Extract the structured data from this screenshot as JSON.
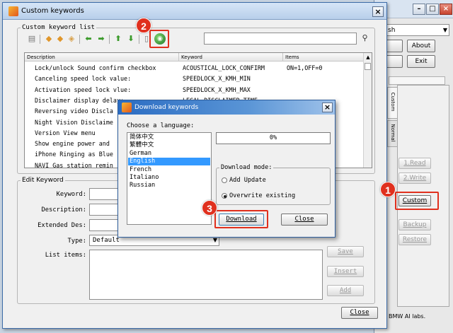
{
  "main_app": {
    "lang_select_value": "sh",
    "buttons": {
      "about": "About",
      "exit": "Exit"
    },
    "vtabs": [
      "Custom",
      "Normal"
    ],
    "side_buttons": {
      "read": "1.Read",
      "write": "2.Write",
      "custom": "Custom",
      "backup": "Backup",
      "restore": "Restore"
    },
    "status_text": "BMW AI labs."
  },
  "kw_window": {
    "title": "Custom keywords",
    "close_glyph": "×",
    "list_group_label": "Custom keyword list",
    "columns": [
      "Description",
      "Keyword",
      "Items"
    ],
    "rows": [
      {
        "description": "Lock/unlock Sound confirm checkbox",
        "keyword": "ACOUSTICAL_LOCK_CONFIRM",
        "items": "ON=1,OFF=0"
      },
      {
        "description": "Canceling speed lock value:",
        "keyword": "SPEEDLOCK_X_KMH_MIN",
        "items": ""
      },
      {
        "description": "Activation speed lock vlue:",
        "keyword": "SPEEDLOCK_X_KMH_MAX",
        "items": ""
      },
      {
        "description": "Disclaimer display delay:",
        "keyword": "LEGAL_DISCLAIMER_TIME",
        "items": ""
      },
      {
        "description": "Reversing video Discla",
        "keyword": "",
        "items": ""
      },
      {
        "description": "Night Vision Disclaime",
        "keyword": "",
        "items": ""
      },
      {
        "description": "Version View menu",
        "keyword": "",
        "items": ""
      },
      {
        "description": "Show engine power and",
        "keyword": "",
        "items": ""
      },
      {
        "description": "iPhone Ringing as Blue",
        "keyword": "",
        "items": ""
      },
      {
        "description": "NAVI Gas station remin",
        "keyword": "",
        "items": ""
      }
    ],
    "edit_group_label": "Edit Keyword",
    "fields": {
      "keyword": "Keyword:",
      "description": "Description:",
      "extended": "Extended Des:",
      "type": "Type:",
      "type_value": "Default",
      "list_items": "List items:"
    },
    "edit_buttons": {
      "save": "Save",
      "insert": "Insert",
      "add": "Add"
    },
    "close_label": "Close"
  },
  "dl_dialog": {
    "title": "Download keywords",
    "close_glyph": "×",
    "choose_label": "Choose a language:",
    "languages": [
      "简体中文",
      "繁體中文",
      "German",
      "English",
      "French",
      "Italiano",
      "Russian"
    ],
    "selected_language": "English",
    "progress_text": "0%",
    "progress_value": 0,
    "mode_group_label": "Download mode:",
    "mode_options": [
      "Add Update",
      "Overwrite existing"
    ],
    "selected_mode": "Overwrite existing",
    "download_label": "Download",
    "close_label": "Close"
  },
  "callouts": {
    "one": "1",
    "two": "2",
    "three": "3"
  },
  "colors": {
    "callout_red": "#e0301e",
    "selection_blue": "#3399ff",
    "dialog_title_blue": "#2b6cc2"
  }
}
